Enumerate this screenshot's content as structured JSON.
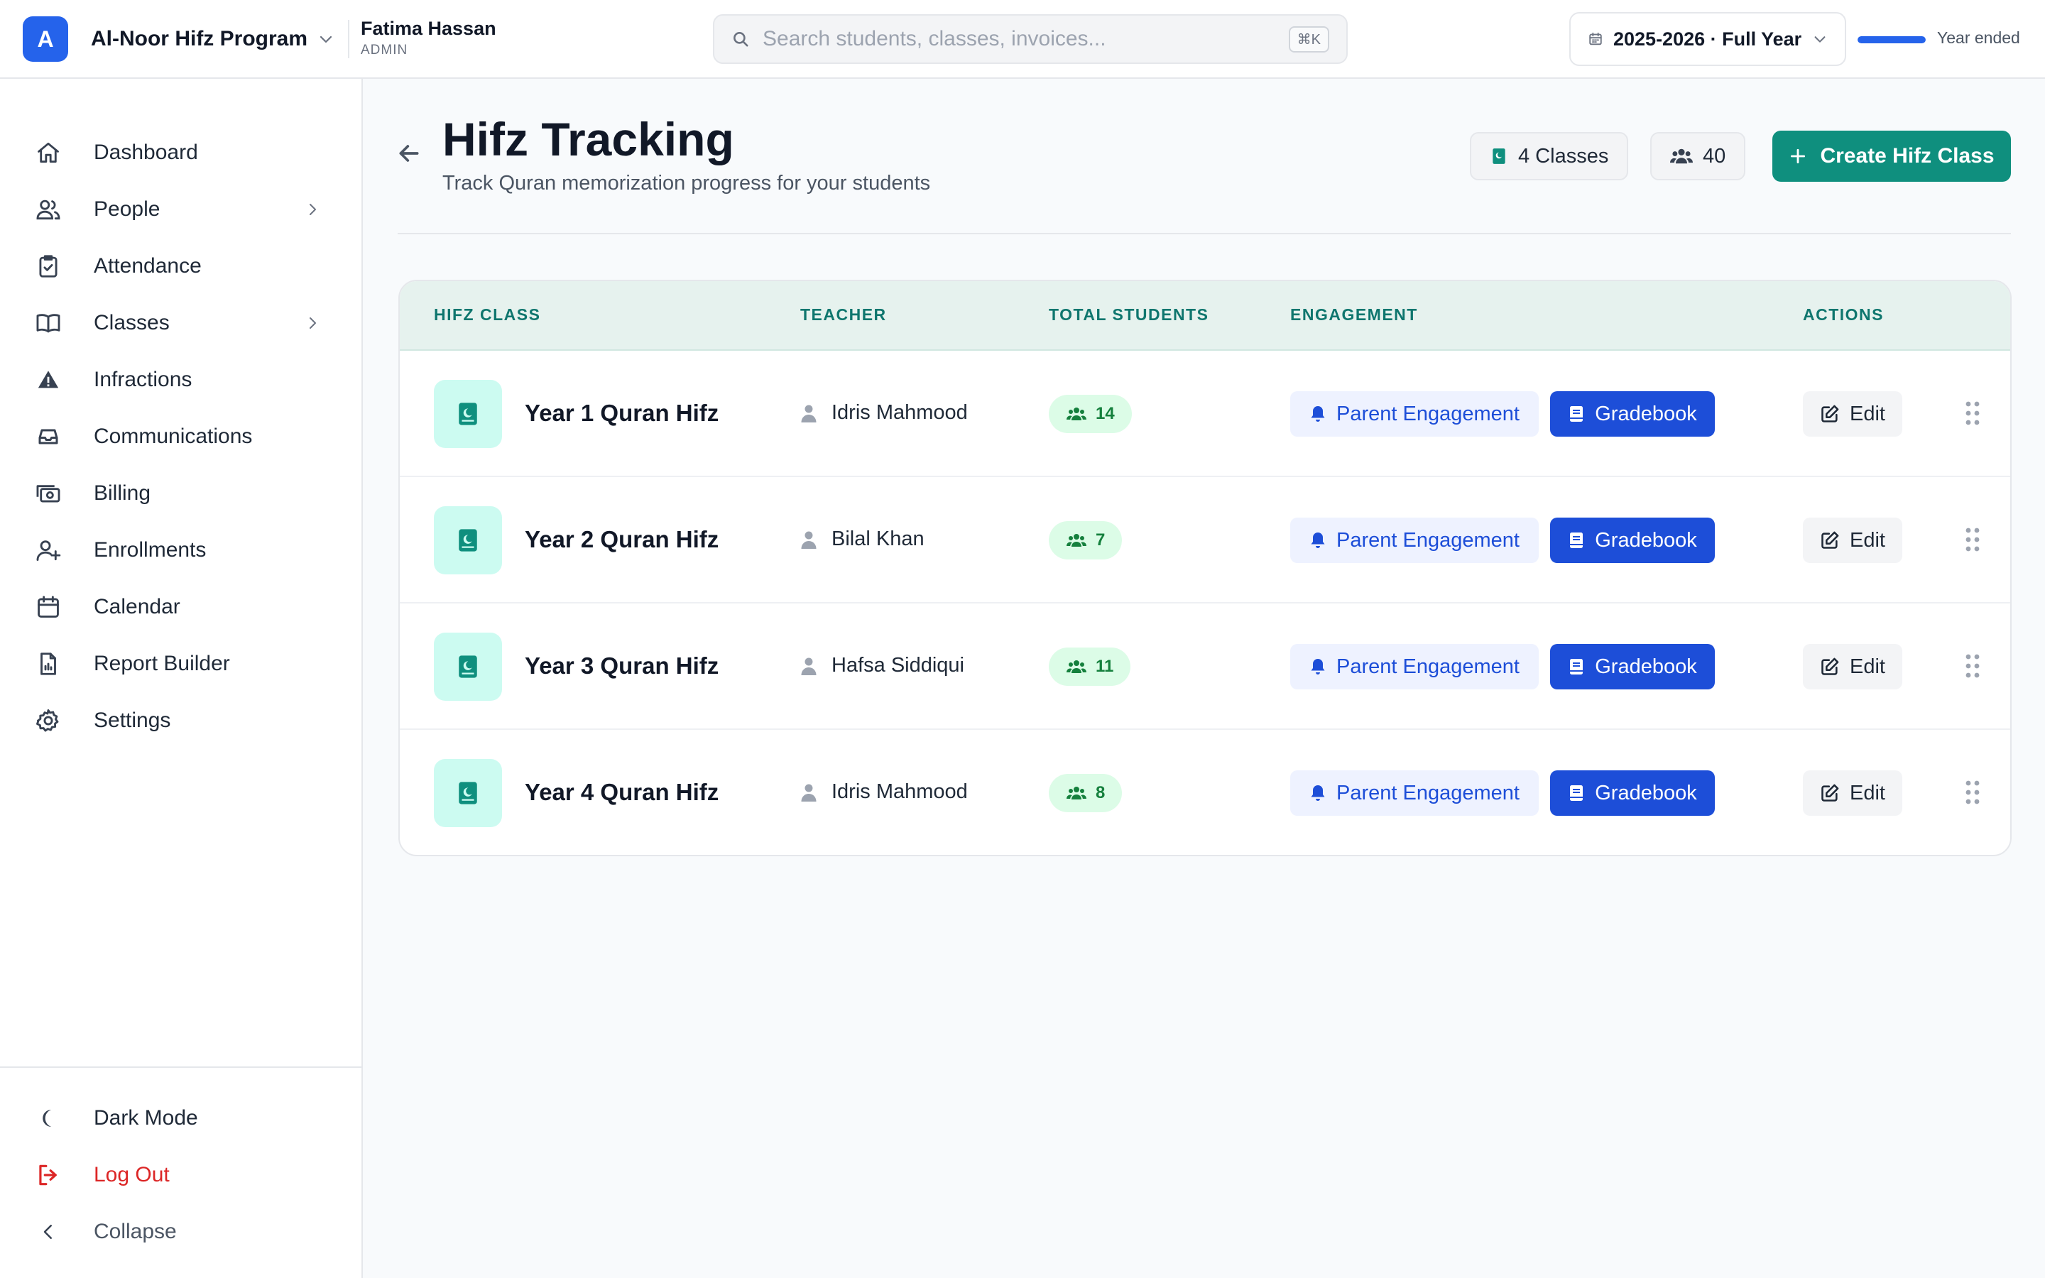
{
  "org": {
    "initial": "A",
    "name": "Al-Noor Hifz Program"
  },
  "user": {
    "name": "Fatima Hassan",
    "role": "ADMIN"
  },
  "search": {
    "placeholder": "Search students, classes, invoices...",
    "shortcut": "⌘K"
  },
  "school_year": {
    "label": "2025-2026 · Full Year",
    "status": "Year ended",
    "progress": 1.0
  },
  "sidebar": {
    "items": [
      {
        "label": "Dashboard",
        "icon": "home-icon"
      },
      {
        "label": "People",
        "icon": "users-icon",
        "has_submenu": true
      },
      {
        "label": "Attendance",
        "icon": "clipboard-check-icon"
      },
      {
        "label": "Classes",
        "icon": "book-open-icon",
        "has_submenu": true
      },
      {
        "label": "Infractions",
        "icon": "warning-icon"
      },
      {
        "label": "Communications",
        "icon": "inbox-icon"
      },
      {
        "label": "Billing",
        "icon": "money-icon"
      },
      {
        "label": "Enrollments",
        "icon": "user-plus-icon"
      },
      {
        "label": "Calendar",
        "icon": "calendar-icon"
      },
      {
        "label": "Report Builder",
        "icon": "report-icon"
      },
      {
        "label": "Settings",
        "icon": "gear-icon"
      }
    ],
    "bottom": [
      {
        "label": "Dark Mode",
        "icon": "moon-icon"
      },
      {
        "label": "Log Out",
        "icon": "logout-icon",
        "color": "#dc2626"
      },
      {
        "label": "Collapse",
        "icon": "chevron-left-icon"
      }
    ]
  },
  "page": {
    "title": "Hifz Tracking",
    "subtitle": "Track Quran memorization progress for your students",
    "classes_chip": "4 Classes",
    "students_chip": "40",
    "create_button": "Create Hifz Class"
  },
  "table": {
    "headers": [
      "HIFZ CLASS",
      "TEACHER",
      "TOTAL STUDENTS",
      "ENGAGEMENT",
      "ACTIONS"
    ],
    "rows": [
      {
        "class_name": "Year 1 Quran Hifz",
        "teacher": "Idris Mahmood",
        "students": "14"
      },
      {
        "class_name": "Year 2 Quran Hifz",
        "teacher": "Bilal Khan",
        "students": "7"
      },
      {
        "class_name": "Year 3 Quran Hifz",
        "teacher": "Hafsa Siddiqui",
        "students": "11"
      },
      {
        "class_name": "Year 4 Quran Hifz",
        "teacher": "Idris Mahmood",
        "students": "8"
      }
    ],
    "row_actions": {
      "engagement": "Parent Engagement",
      "gradebook": "Gradebook",
      "edit": "Edit"
    }
  },
  "colors": {
    "primary": "#2563eb",
    "brand_teal": "#0f8f7e",
    "header_teal_bg": "#e6f2ee",
    "count_pill_bg": "#dcfce7",
    "gradebook_bg": "#1d4ed8",
    "danger": "#dc2626"
  }
}
